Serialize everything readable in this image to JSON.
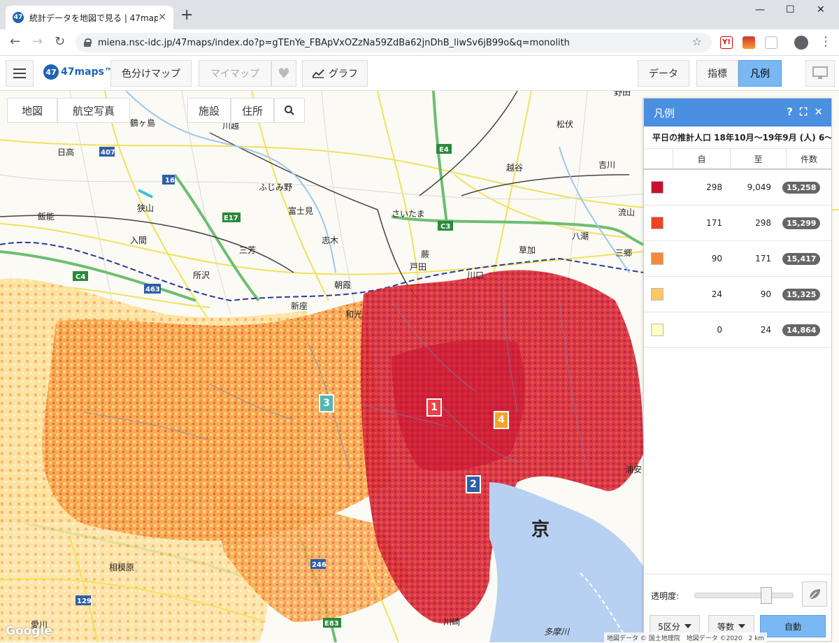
{
  "browser": {
    "tab_title": "統計データを地図で見る | 47maps",
    "tab_favicon": "47",
    "url": "miena.nsc-idc.jp/47maps/index.do?p=gTEnYe_FBApVxOZzNa59ZdBa62jnDhB_liwSv6jB99o&q=monolith"
  },
  "app": {
    "logo_badge": "47",
    "logo_text": "47maps™",
    "color_map_label": "色分けマップ",
    "mymap_label": "マイマップ",
    "graph_label": "グラフ",
    "data_label": "データ",
    "indicator_label": "指標",
    "legend_label": "凡例"
  },
  "map_controls": {
    "map_label": "地図",
    "aerial_label": "航空写真",
    "facility_label": "施設",
    "address_label": "住所"
  },
  "map_labels": [
    {
      "text": "鶴ヶ島"
    },
    {
      "text": "川越"
    },
    {
      "text": "日高"
    },
    {
      "text": "ふじみ野"
    },
    {
      "text": "さいたま"
    },
    {
      "text": "越谷"
    },
    {
      "text": "吉川"
    },
    {
      "text": "松伏"
    },
    {
      "text": "野田"
    },
    {
      "text": "流山"
    },
    {
      "text": "狭山"
    },
    {
      "text": "富士見"
    },
    {
      "text": "飯能"
    },
    {
      "text": "入間"
    },
    {
      "text": "志木"
    },
    {
      "text": "三芳"
    },
    {
      "text": "蕨"
    },
    {
      "text": "戸田"
    },
    {
      "text": "草加"
    },
    {
      "text": "八潮"
    },
    {
      "text": "三郷"
    },
    {
      "text": "所沢"
    },
    {
      "text": "朝霞"
    },
    {
      "text": "川口"
    },
    {
      "text": "新座"
    },
    {
      "text": "和光"
    },
    {
      "text": "京"
    },
    {
      "text": "相模原"
    },
    {
      "text": "愛川"
    },
    {
      "text": "多摩川"
    },
    {
      "text": "川崎"
    },
    {
      "text": "浦安"
    }
  ],
  "route_labels": [
    "407",
    "16",
    "E17",
    "C4",
    "463",
    "E4",
    "C3",
    "246",
    "129",
    "E83"
  ],
  "pins": [
    {
      "label": "1",
      "color": "#e8434a"
    },
    {
      "label": "2",
      "color": "#2e5fa8"
    },
    {
      "label": "3",
      "color": "#4fb8b0"
    },
    {
      "label": "4",
      "color": "#f2a42a"
    }
  ],
  "legend": {
    "title": "凡例",
    "subtitle": "平日の推計人口 18年10月〜19年9月 (人) 6〜",
    "col_from": "自",
    "col_to": "至",
    "col_count": "件数",
    "rows": [
      {
        "color": "#c8102e",
        "from": "298",
        "to": "9,049",
        "count": "15,258"
      },
      {
        "color": "#ee4422",
        "from": "171",
        "to": "298",
        "count": "15,299"
      },
      {
        "color": "#f7893a",
        "from": "90",
        "to": "171",
        "count": "15,417"
      },
      {
        "color": "#fdc766",
        "from": "24",
        "to": "90",
        "count": "15,325"
      },
      {
        "color": "#ffffc2",
        "from": "0",
        "to": "24",
        "count": "14,864"
      }
    ],
    "opacity_label": "透明度:",
    "opacity_value": 0.75,
    "classes_label": "5区分",
    "method_label": "等数",
    "auto_label": "自動"
  },
  "attribution": "地図データ © 国土地理院　地図データ ©2020　2 km",
  "google_logo": "Google"
}
